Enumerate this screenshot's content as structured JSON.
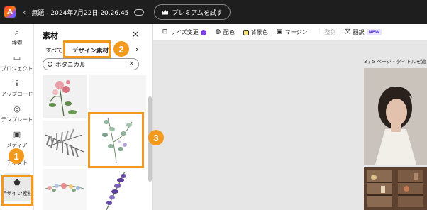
{
  "app": {
    "logo_letter": "A",
    "back_glyph": "‹",
    "doc_title": "無題 - 2024年7月22日 20.26.45",
    "premium_label": "プレミアムを試す"
  },
  "rail": {
    "items": [
      {
        "label": "検索",
        "icon": "search-icon",
        "glyph": "⌕"
      },
      {
        "label": "プロジェクト",
        "icon": "folder-icon",
        "glyph": "▭"
      },
      {
        "label": "アップロード",
        "icon": "upload-icon",
        "glyph": "⇪"
      },
      {
        "label": "テンプレート",
        "icon": "template-icon",
        "glyph": "◎"
      },
      {
        "label": "メディア",
        "icon": "media-icon",
        "glyph": "▣"
      },
      {
        "label": "テキスト",
        "icon": "text-icon",
        "glyph": "T"
      },
      {
        "label": "デザイン素材",
        "icon": "shapes-icon",
        "glyph": "⬟"
      }
    ]
  },
  "panel": {
    "title": "素材",
    "close_glyph": "×",
    "tabs": [
      {
        "label": "すべて",
        "active": false
      },
      {
        "label": "デザイン素材",
        "active": true
      }
    ],
    "tabs_arrow": "›",
    "search_value": "ボタニカル",
    "search_clear": "×"
  },
  "toolbar": {
    "items": [
      {
        "label": "サイズ変更",
        "icon": "resize-icon",
        "glyph": "⊡",
        "dim": false
      },
      {
        "label": "配色",
        "icon": "palette-icon",
        "glyph": "◍",
        "dim": false
      },
      {
        "label": "背景色",
        "icon": "background-color-icon",
        "glyph": "▢",
        "dim": false
      },
      {
        "label": "マージン",
        "icon": "margin-icon",
        "glyph": "▣",
        "dim": false
      },
      {
        "label": "整列",
        "icon": "align-icon",
        "glyph": "⫶",
        "dim": true
      },
      {
        "label": "翻訳",
        "icon": "translate-icon",
        "glyph": "文",
        "dim": false
      }
    ],
    "new_badge": "NEW"
  },
  "canvas": {
    "page_label": "3 / 5 ページ - タイトルを追"
  },
  "annotations": {
    "badge1": "1",
    "badge2": "2",
    "badge3": "3"
  },
  "colors": {
    "accent": "#f39a1e",
    "topbar": "#1e1e1e",
    "canvas_bg": "#e6e6e6"
  }
}
